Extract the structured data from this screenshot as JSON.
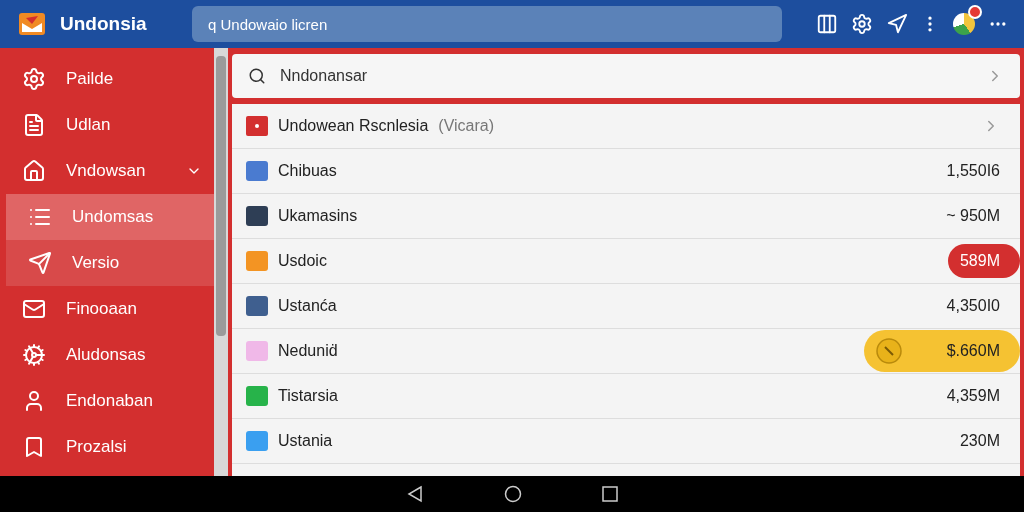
{
  "app": {
    "title": "Undonsia",
    "search": {
      "placeholder": "q Undowaio licren"
    }
  },
  "sidebar": {
    "items": [
      {
        "label": "Pailde",
        "selected": false,
        "hovered": false
      },
      {
        "label": "Udlan",
        "selected": false,
        "hovered": false
      },
      {
        "label": "Vndowsan",
        "selected": false,
        "hovered": false,
        "expanded": true
      },
      {
        "label": "Undomsas",
        "selected": true,
        "hovered": false
      },
      {
        "label": "Versio",
        "selected": false,
        "hovered": true
      },
      {
        "label": "Finooaan",
        "selected": false,
        "hovered": false
      },
      {
        "label": "Aludonsas",
        "selected": false,
        "hovered": false
      },
      {
        "label": "Endonaban",
        "selected": false,
        "hovered": false
      },
      {
        "label": "Prozalsi",
        "selected": false,
        "hovered": false
      }
    ]
  },
  "search": {
    "value": "Nndonansar"
  },
  "list": {
    "header": {
      "name": "Undowean Rscnlesia",
      "note": "(Vicara)"
    },
    "rows": [
      {
        "name": "Chibuas",
        "value": "1,550I6",
        "kind": "plain",
        "color": "#4a7bd0"
      },
      {
        "name": "Ukamasins",
        "value": "~ 950M",
        "kind": "plain",
        "color": "#2e3e55"
      },
      {
        "name": "Usdoic",
        "value": "589M",
        "kind": "red",
        "color": "#f39423"
      },
      {
        "name": "Ustanća",
        "value": "4,350I0",
        "kind": "plain",
        "color": "#3f5f8f"
      },
      {
        "name": "Neduniḋ",
        "value": "$.660M",
        "kind": "gold",
        "color": "#f0b8e8"
      },
      {
        "name": "Tistarsia",
        "value": "4,359M",
        "kind": "plain",
        "color": "#27b34a"
      },
      {
        "name": "Ustania",
        "value": "230M",
        "kind": "plain",
        "color": "#3a9ff0"
      }
    ]
  }
}
